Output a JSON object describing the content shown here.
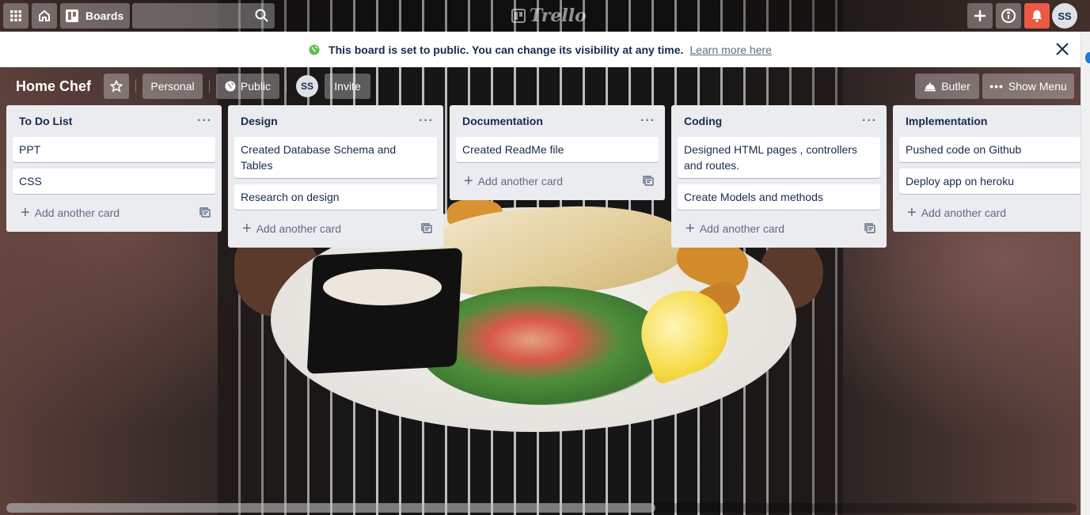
{
  "header": {
    "boards_label": "Boards",
    "search_placeholder": "",
    "logo_text": "Trello",
    "user_initials": "SS"
  },
  "banner": {
    "message": "This board is set to public. You can change its visibility at any time.",
    "link": "Learn more here"
  },
  "board": {
    "title": "Home Chef",
    "team_label": "Personal",
    "visibility_label": "Public",
    "member_initials": "SS",
    "invite_label": "Invite",
    "butler_label": "Butler",
    "menu_label": "Show Menu"
  },
  "add_card_label": "Add another card",
  "lists": [
    {
      "title": "To Do List",
      "cards": [
        "PPT",
        "CSS"
      ]
    },
    {
      "title": "Design",
      "cards": [
        "Created Database Schema and Tables",
        "Research on design"
      ]
    },
    {
      "title": "Documentation",
      "cards": [
        "Created ReadMe file"
      ]
    },
    {
      "title": "Coding",
      "cards": [
        "Designed HTML pages , controllers and routes.",
        "Create Models and methods"
      ]
    },
    {
      "title": "Implementation",
      "cards": [
        "Pushed code on Github",
        "Deploy app on heroku"
      ]
    }
  ],
  "colors": {
    "notification": "#eb5a46",
    "list_bg": "#ebecf0",
    "globe": "#61bd4f"
  }
}
